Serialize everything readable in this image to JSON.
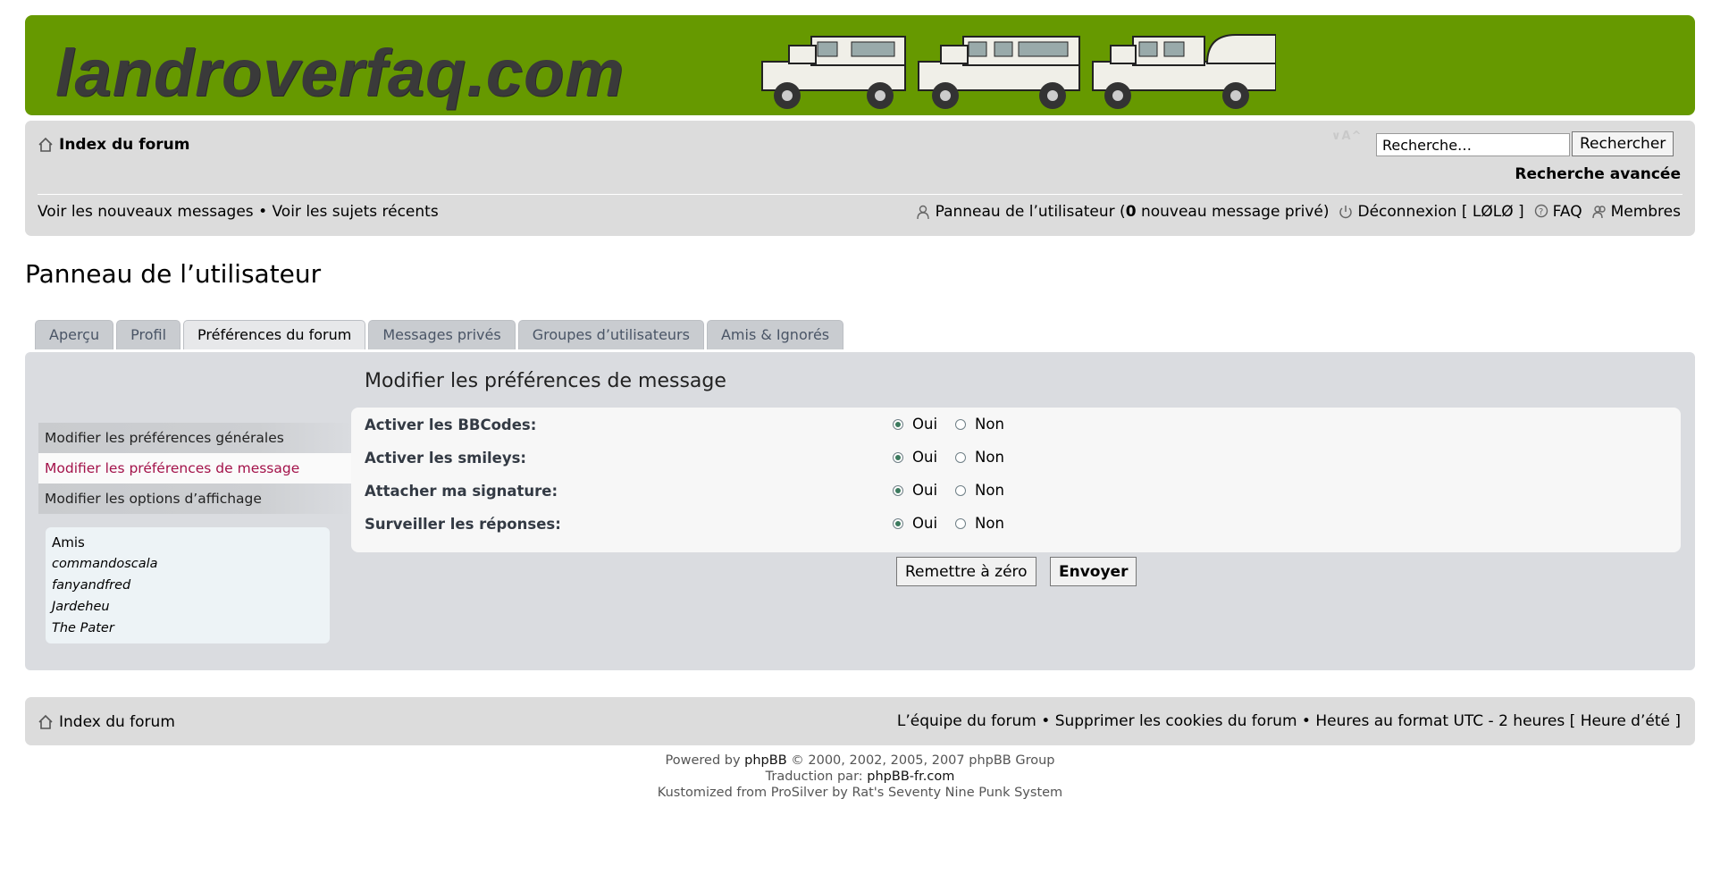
{
  "banner": {
    "logo_text": "landroverfaq.com"
  },
  "header": {
    "home_label": "Index du forum",
    "font_size_label": "∨A^",
    "search_placeholder": "Recherche…",
    "search_button": "Rechercher",
    "advanced_search": "Recherche avancée",
    "new_messages": "Voir les nouveaux messages",
    "bullet": "•",
    "recent_topics": "Voir les sujets récents",
    "user_panel_prefix": "Panneau de l’utilisateur (",
    "pm_count": "0",
    "user_panel_suffix": " nouveau message privé)",
    "logout": "Déconnexion",
    "username": "[ LØLØ ]",
    "faq": "FAQ",
    "members": "Membres"
  },
  "page_title": "Panneau de l’utilisateur",
  "tabs": [
    {
      "label": "Aperçu"
    },
    {
      "label": "Profil"
    },
    {
      "label": "Préférences du forum",
      "active": true
    },
    {
      "label": "Messages privés"
    },
    {
      "label": "Groupes d’utilisateurs"
    },
    {
      "label": "Amis & Ignorés"
    }
  ],
  "side_menu": [
    {
      "label": "Modifier les préférences générales"
    },
    {
      "label": "Modifier les préférences de message",
      "active": true
    },
    {
      "label": "Modifier les options d’affichage"
    }
  ],
  "friends": {
    "title": "Amis",
    "list": [
      "commandoscala",
      "fanyandfred",
      "Jardeheu",
      "The Pater"
    ]
  },
  "section_title": "Modifier les préférences de message",
  "prefs": [
    {
      "label": "Activer les BBCodes:",
      "value": "Oui"
    },
    {
      "label": "Activer les smileys:",
      "value": "Oui"
    },
    {
      "label": "Attacher ma signature:",
      "value": "Oui"
    },
    {
      "label": "Surveiller les réponses:",
      "value": "Oui"
    }
  ],
  "option_yes": "Oui",
  "option_no": "Non",
  "buttons": {
    "reset": "Remettre à zéro",
    "submit": "Envoyer"
  },
  "footer": {
    "home_label": "Index du forum",
    "team": "L’équipe du forum",
    "bullet": " • ",
    "delete_cookies": "Supprimer les cookies du forum",
    "timezone": "Heures au format UTC - 2 heures [ Heure d’été ]"
  },
  "copyright": {
    "powered_prefix": "Powered by ",
    "phpbb": "phpBB",
    "powered_suffix": " © 2000, 2002, 2005, 2007 phpBB Group",
    "translation_prefix": "Traduction par: ",
    "translation_link": "phpBB-fr.com",
    "kustom": "Kustomized from ProSilver by Rat's Seventy Nine Punk System"
  },
  "colors": {
    "banner": "#669900",
    "nav_bg": "#dcdcdc",
    "active_side": "#a3124a"
  }
}
